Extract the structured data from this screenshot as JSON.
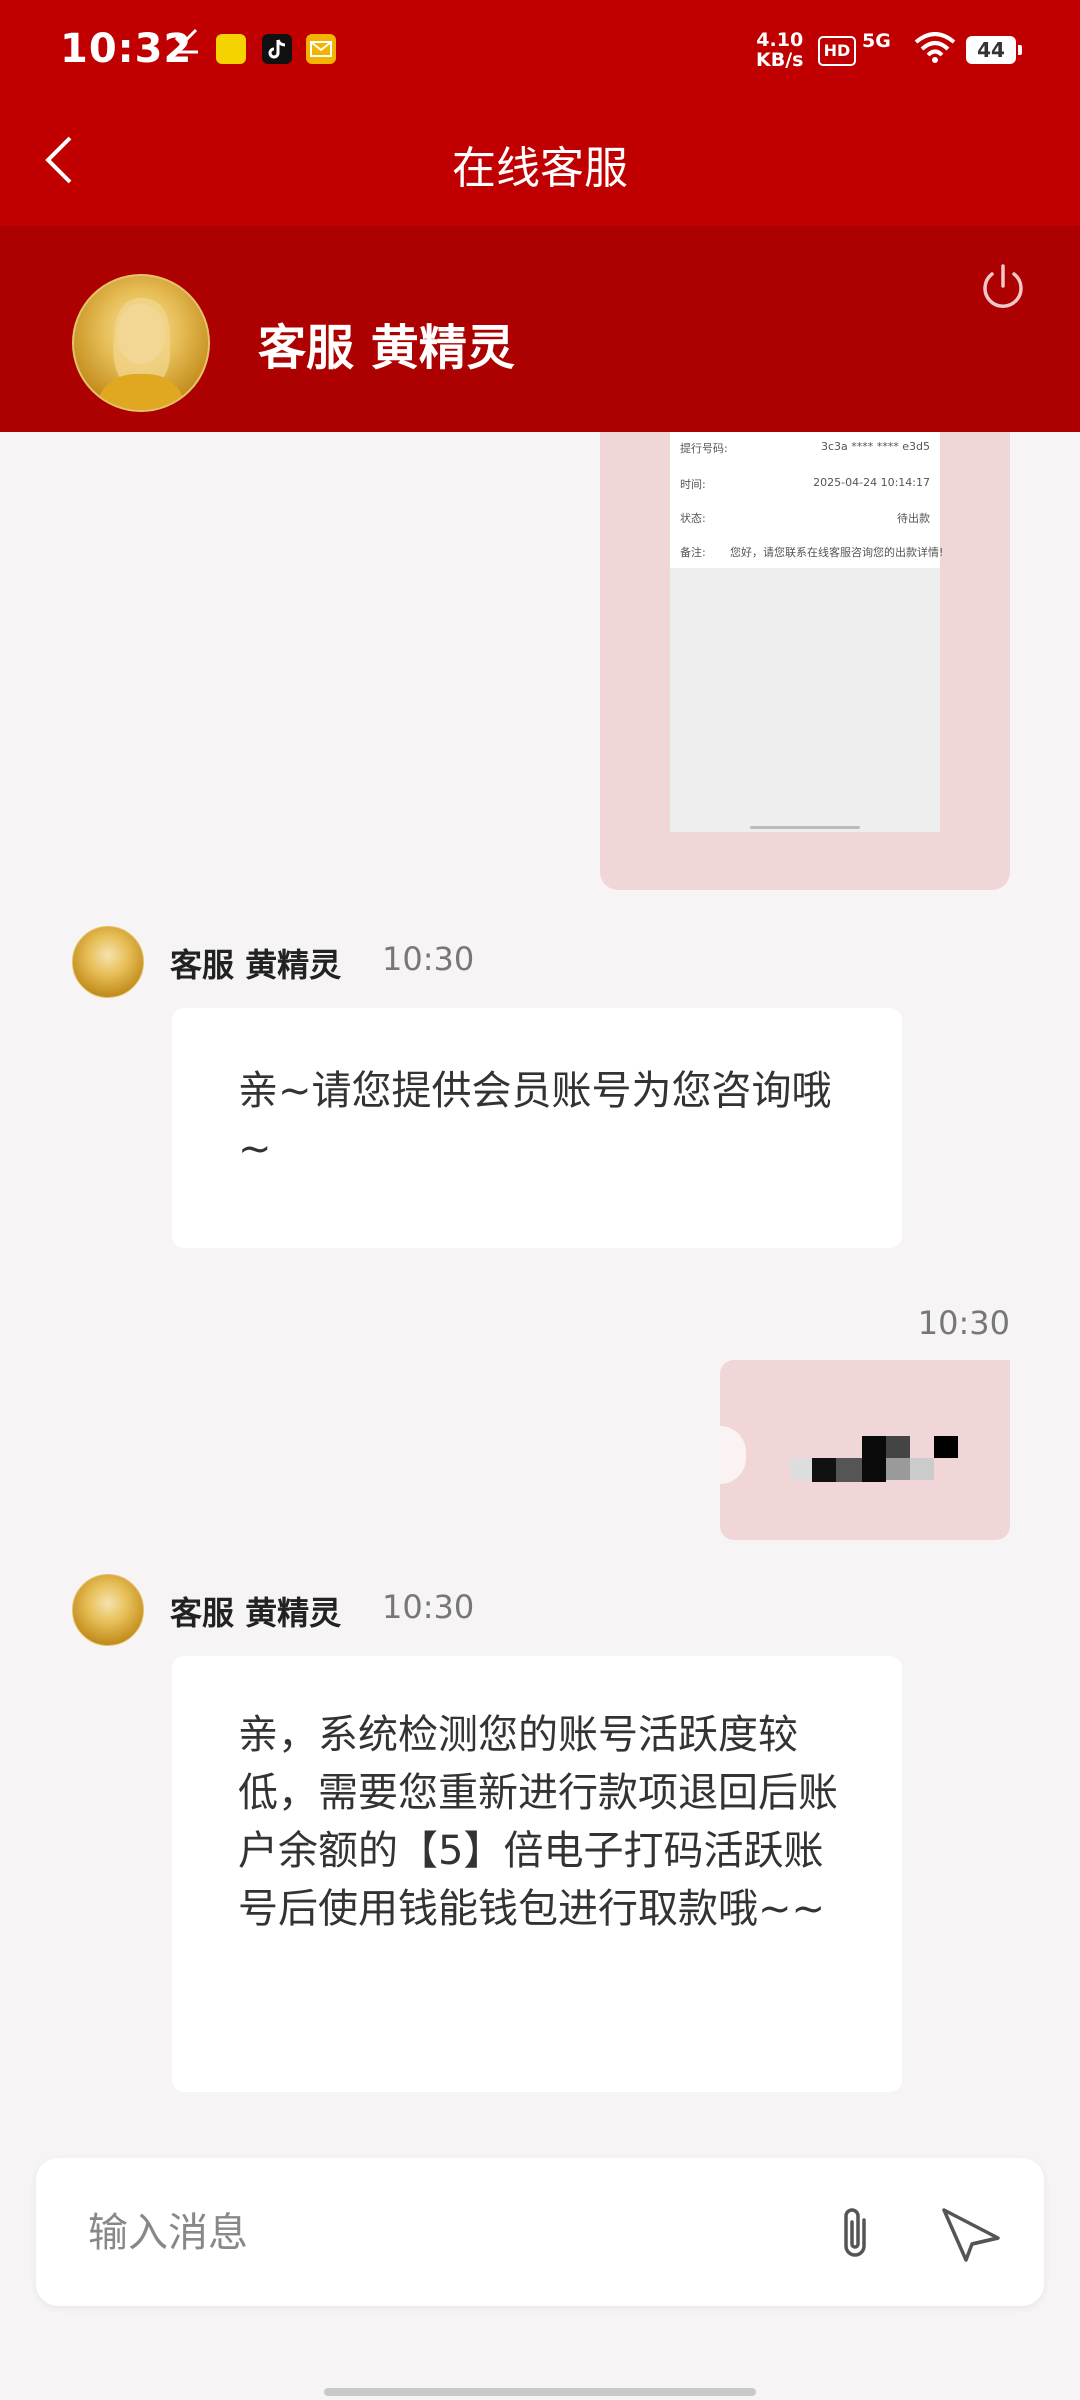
{
  "status_bar": {
    "time": "10:32",
    "net_speed_value": "4.10",
    "net_speed_unit": "KB/s",
    "hd_label": "HD",
    "network_label": "5G",
    "battery": "44"
  },
  "header": {
    "title": "在线客服",
    "agent_name": "客服 黄精灵"
  },
  "receipt": {
    "rows": [
      {
        "label": "提行号码:",
        "value": "3c3a **** **** e3d5"
      },
      {
        "label": "时间:",
        "value": "2025-04-24 10:14:17"
      },
      {
        "label": "状态:",
        "value": "待出款"
      },
      {
        "label": "备注:",
        "value": "您好，请您联系在线客服咨询您的出款详情!"
      }
    ]
  },
  "messages": [
    {
      "sender": "客服 黄精灵",
      "time": "10:30",
      "text": "亲~请您提供会员账号为您咨询哦~"
    },
    {
      "user_time": "10:30"
    },
    {
      "sender": "客服 黄精灵",
      "time": "10:30",
      "text": "亲，系统检测您的账号活跃度较低，需要您重新进行款项退回后账户余额的【5】倍电子打码活跃账号后使用钱能钱包进行取款哦~~"
    }
  ],
  "input": {
    "placeholder": "输入消息"
  },
  "colors": {
    "header_red": "#c00000",
    "agent_bar_red": "#ad0000",
    "user_bubble": "#f1d6d8",
    "background": "#f6f4f4"
  }
}
